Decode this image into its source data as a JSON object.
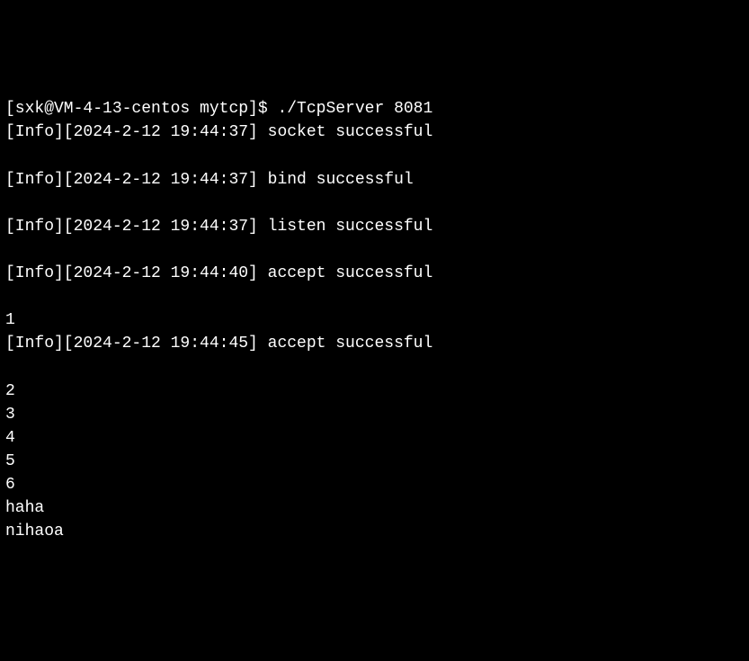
{
  "terminal": {
    "prompt_line": "[sxk@VM-4-13-centos mytcp]$ ./TcpServer 8081",
    "lines": [
      "[Info][2024-2-12 19:44:37] socket successful",
      "",
      "[Info][2024-2-12 19:44:37] bind successful",
      "",
      "[Info][2024-2-12 19:44:37] listen successful",
      "",
      "[Info][2024-2-12 19:44:40] accept successful",
      "",
      "1",
      "[Info][2024-2-12 19:44:45] accept successful",
      "",
      "2",
      "3",
      "4",
      "5",
      "6",
      "haha",
      "nihaoa"
    ]
  }
}
